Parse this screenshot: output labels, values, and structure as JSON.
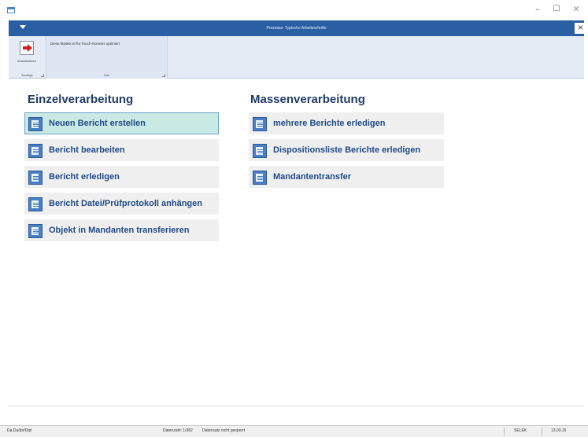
{
  "window": {
    "minimize_glyph": "–",
    "maximize_glyph": "☐",
    "close_glyph": "✕"
  },
  "inner": {
    "title": "Prozesse: Typische Arbeitsschritte",
    "close_glyph": "×"
  },
  "ribbon": {
    "exit_button_label": "Zurücksetzen",
    "group1_label": "Anzeige",
    "info_text": "Diese Maske ist für Touch-Screens optimiert",
    "group2_label": "Info"
  },
  "einzel": {
    "heading": "Einzelverarbeitung",
    "actions": [
      {
        "label": "Neuen Bericht erstellen"
      },
      {
        "label": "Bericht bearbeiten"
      },
      {
        "label": "Bericht erledigen"
      },
      {
        "label": "Bericht Datei/Prüfprotokoll anhängen"
      },
      {
        "label": "Objekt in Mandanten transferieren"
      }
    ]
  },
  "massen": {
    "heading": "Massenverarbeitung",
    "actions": [
      {
        "label": "mehrere Berichte erledigen"
      },
      {
        "label": "Dispositionsliste Berichte erledigen"
      },
      {
        "label": "Mandantentransfer"
      }
    ]
  },
  "statusbar": {
    "cell1": "Da,Da/Ipr/Dipl",
    "cell2": "Datenzahl: 1/382",
    "cell3": "Datensatz nicht gesperrt",
    "cell4": "SELEK",
    "cell5": "13.03.15"
  },
  "colors": {
    "title_bar": "#2b5fa3",
    "ribbon": "#e4ebf5",
    "heading": "#1f3c66",
    "action_text": "#1f4a8a",
    "selected_bg": "#c9e9e4"
  }
}
